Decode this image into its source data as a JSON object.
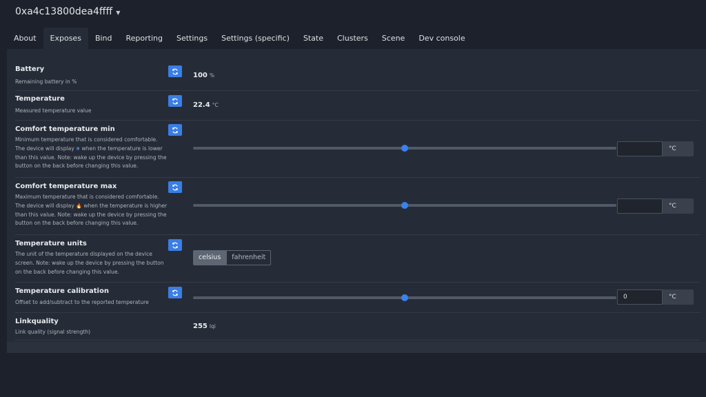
{
  "device": {
    "name": "0xa4c13800dea4ffff"
  },
  "tabs": [
    "About",
    "Exposes",
    "Bind",
    "Reporting",
    "Settings",
    "Settings (specific)",
    "State",
    "Clusters",
    "Scene",
    "Dev console"
  ],
  "active_tab": "Exposes",
  "exposes": {
    "battery": {
      "title": "Battery",
      "desc": "Remaining battery in %",
      "value": "100",
      "unit": "%"
    },
    "temperature": {
      "title": "Temperature",
      "desc": "Measured temperature value",
      "value": "22.4",
      "unit": "°C"
    },
    "comfort_min": {
      "title": "Comfort temperature min",
      "desc_l1": "Minimum temperature that is considered comfortable.",
      "desc_l2a": "The device will display",
      "desc_icon": "❄",
      "desc_l2b": "when the temperature is lower",
      "desc_l3": "than this value. Note: wake up the device by pressing the",
      "desc_l4": "button on the back before changing this value.",
      "value": "",
      "unit": "°C",
      "slider_fraction": 0.5
    },
    "comfort_max": {
      "title": "Comfort temperature max",
      "desc_l1": "Maximum temperature that is considered comfortable.",
      "desc_l2a": "The device will display",
      "desc_icon": "🔥",
      "desc_l2b": "when the temperature is higher",
      "desc_l3": "than this value. Note: wake up the device by pressing the",
      "desc_l4": "button on the back before changing this value.",
      "value": "",
      "unit": "°C",
      "slider_fraction": 0.5
    },
    "temp_units": {
      "title": "Temperature units",
      "desc_l1": "The unit of the temperature displayed on the device",
      "desc_l2": "screen. Note: wake up the device by pressing the button",
      "desc_l3": "on the back before changing this value.",
      "options": [
        "celsius",
        "fahrenheit"
      ],
      "selected": "celsius"
    },
    "calibration": {
      "title": "Temperature calibration",
      "desc": "Offset to add/subtract to the reported temperature",
      "value": "0",
      "unit": "°C",
      "slider_fraction": 0.5
    },
    "linkquality": {
      "title": "Linkquality",
      "desc": "Link quality (signal strength)",
      "value": "255",
      "unit": "lqi"
    }
  },
  "colors": {
    "accent": "#3a7ee6",
    "background": "#1c212b",
    "panel": "#262c37"
  },
  "icons": {
    "refresh": "refresh-icon",
    "dropdown": "chevron-down-icon"
  }
}
